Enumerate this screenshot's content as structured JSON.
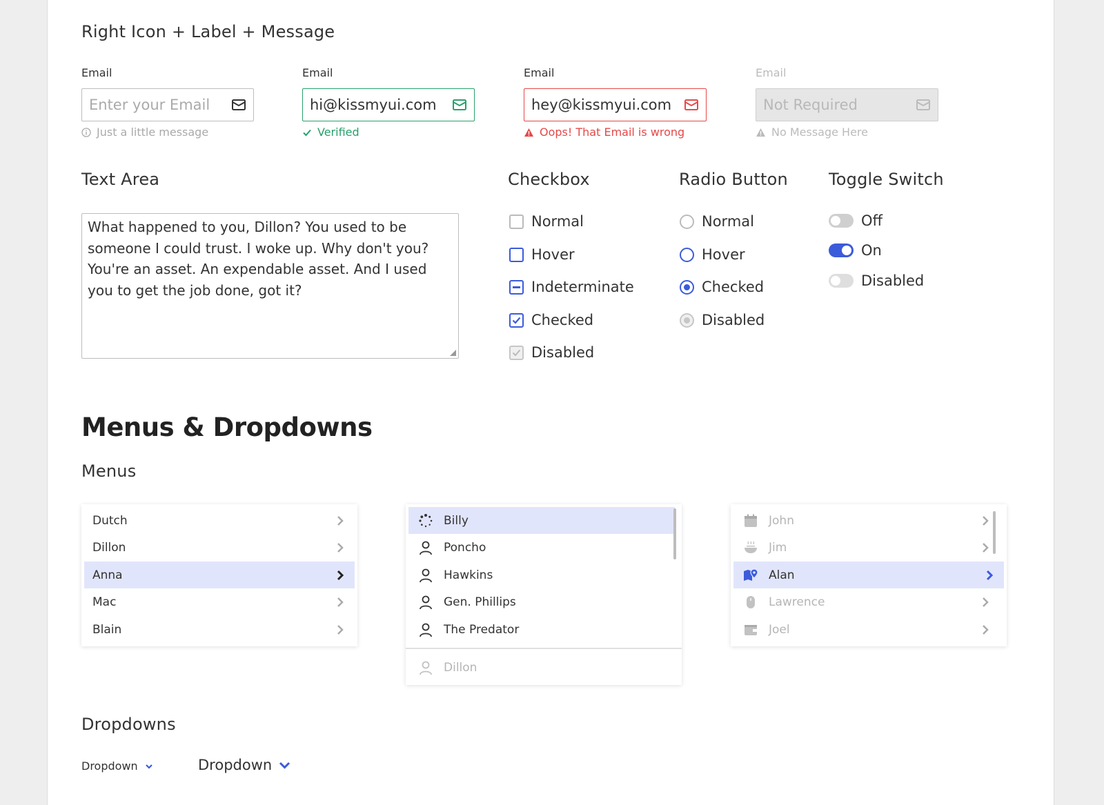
{
  "sections": {
    "right_icon_title": "Right Icon + Label + Message",
    "text_area_title": "Text Area",
    "checkbox_title": "Checkbox",
    "radio_title": "Radio Button",
    "toggle_title": "Toggle Switch",
    "menus_dropdowns_title": "Menus & Dropdowns",
    "menus_title": "Menus",
    "dropdowns_title": "Dropdowns"
  },
  "fields": [
    {
      "label": "Email",
      "value": "Enter your Email",
      "message": "Just a little message",
      "state": "normal"
    },
    {
      "label": "Email",
      "value": "hi@kissmyui.com",
      "message": "Verified",
      "state": "success"
    },
    {
      "label": "Email",
      "value": "hey@kissmyui.com",
      "message": "Oops! That Email is wrong",
      "state": "error"
    },
    {
      "label": "Email",
      "value": "Not Required",
      "message": "No Message Here",
      "state": "disabled"
    }
  ],
  "textarea": {
    "value": "What happened to you, Dillon? You used to be someone I could trust. I woke up. Why don't you? You're an asset. An expendable asset. And I used you to get the job done, got it?"
  },
  "checkboxes": [
    "Normal",
    "Hover",
    "Indeterminate",
    "Checked",
    "Disabled"
  ],
  "radios": [
    "Normal",
    "Hover",
    "Checked",
    "Disabled"
  ],
  "toggles": [
    "Off",
    "On",
    "Disabled"
  ],
  "menu1": {
    "items": [
      "Dutch",
      "Dillon",
      "Anna",
      "Mac",
      "Blain"
    ],
    "active_index": 2
  },
  "menu2": {
    "items": [
      {
        "label": "Billy",
        "icon": "spinner-icon"
      },
      {
        "label": "Poncho",
        "icon": "user-icon"
      },
      {
        "label": "Hawkins",
        "icon": "user-icon"
      },
      {
        "label": "Gen. Phillips",
        "icon": "user-icon"
      },
      {
        "label": "The Predator",
        "icon": "user-icon"
      }
    ],
    "footer": {
      "label": "Dillon",
      "icon": "user-icon"
    },
    "active_index": 0
  },
  "menu3": {
    "items": [
      {
        "label": "John",
        "icon": "calendar-icon"
      },
      {
        "label": "Jim",
        "icon": "food-bowl-icon"
      },
      {
        "label": "Alan",
        "icon": "map-pin-icon"
      },
      {
        "label": "Lawrence",
        "icon": "mouse-icon"
      },
      {
        "label": "Joel",
        "icon": "wallet-icon"
      }
    ],
    "active_index": 2
  },
  "dropdowns": {
    "small_label": "Dropdown",
    "large_label": "Dropdown"
  },
  "colors": {
    "accent": "#3b5bdb",
    "success": "#27a06a",
    "error": "#e64848",
    "active_bg": "#e1e5fb"
  }
}
